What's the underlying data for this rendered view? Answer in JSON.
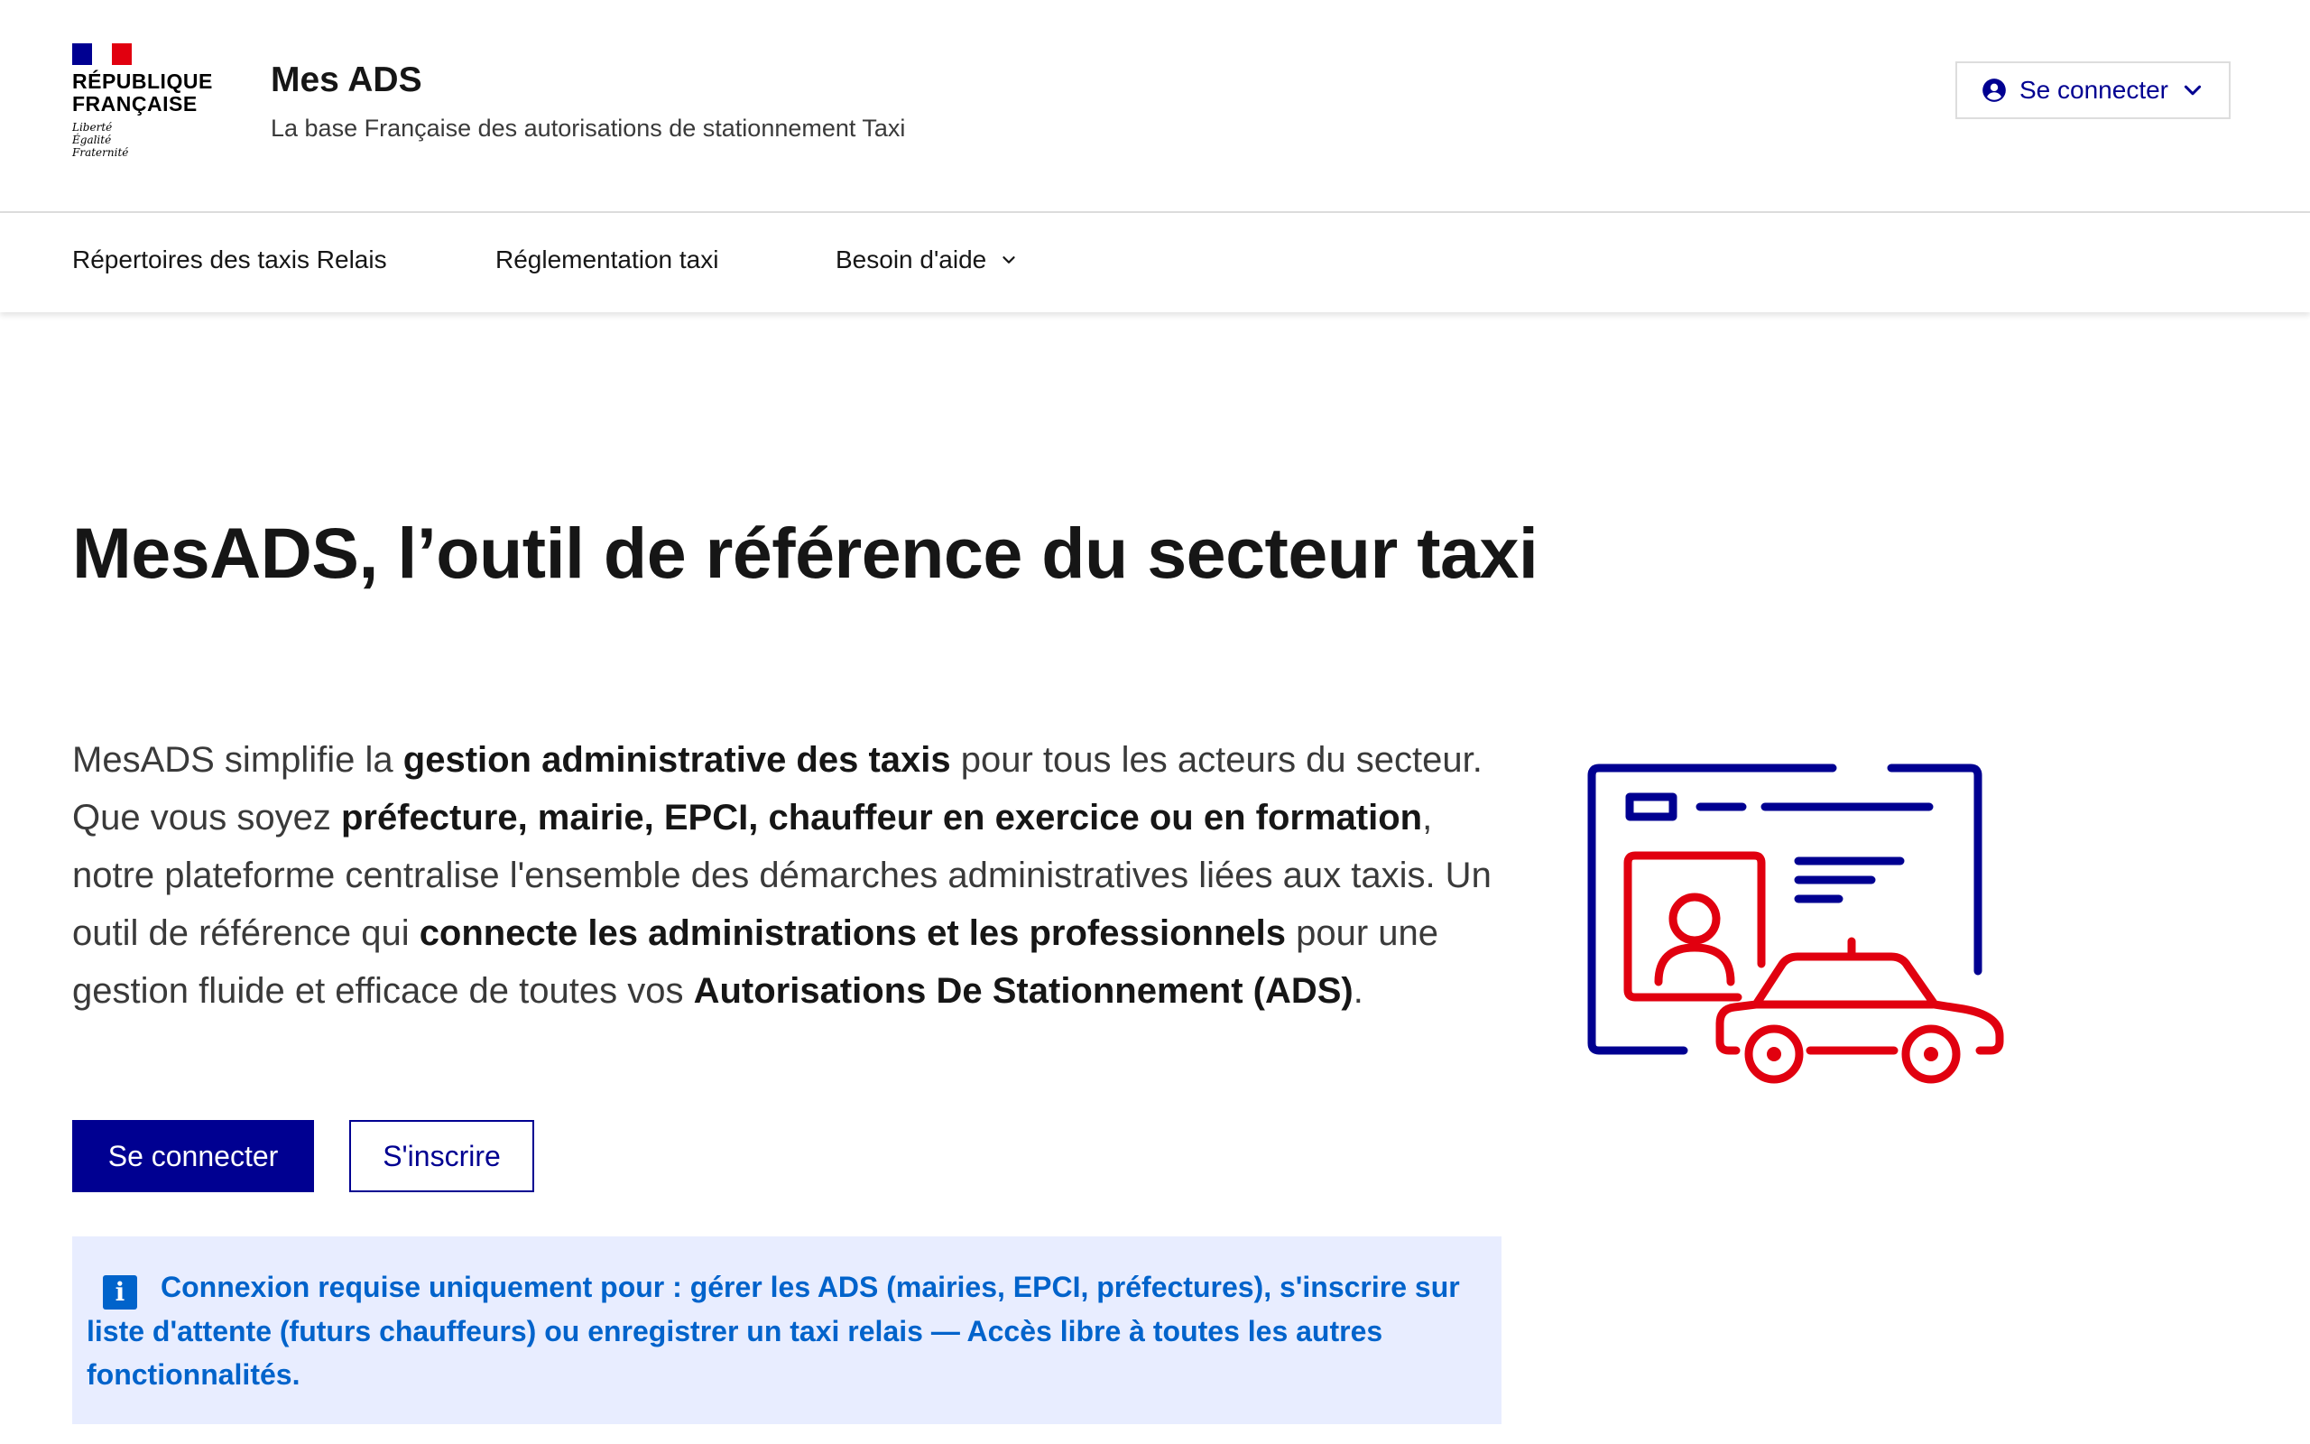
{
  "logo": {
    "title_line1": "RÉPUBLIQUE",
    "title_line2": "FRANÇAISE",
    "motto_line1": "Liberté",
    "motto_line2": "Égalité",
    "motto_line3": "Fraternité"
  },
  "header": {
    "service_title": "Mes ADS",
    "tagline": "La base Française des autorisations de stationnement Taxi",
    "connect_label": "Se connecter"
  },
  "nav": {
    "items": [
      {
        "label": "Répertoires des taxis Relais"
      },
      {
        "label": "Réglementation taxi"
      },
      {
        "label": "Besoin d'aide"
      }
    ]
  },
  "hero": {
    "title": "MesADS, l’outil de référence du secteur taxi",
    "intro_1": "MesADS simplifie la ",
    "bold_1": "gestion administrative des taxis",
    "text_2": " pour tous les acteurs du secteur. Que vous soyez ",
    "bold_2": "préfecture, mairie, EPCI, chauffeur en exercice ou en formation",
    "text_3": ", notre plateforme centralise l'ensemble des démarches administratives liées aux taxis. Un outil de référence qui ",
    "bold_3": "connecte les administrations et les professionnels",
    "text_4": " pour une gestion fluide et efficace de toutes vos ",
    "bold_4": "Autorisations De Stationnement (ADS)",
    "text_5": "."
  },
  "actions": {
    "primary_label": "Se connecter",
    "secondary_label": "S'inscrire"
  },
  "notice": {
    "icon_glyph": "i",
    "text": "Connexion requise uniquement pour : gérer les ADS (mairies, EPCI, préfectures), s'inscrire sur liste d'attente (futurs chauffeurs) ou enregistrer un taxi relais — Accès libre à toutes les autres fonctionnalités."
  },
  "colors": {
    "primary_blue": "#000091",
    "marianne_red": "#e1000f",
    "info_blue": "#0063cb",
    "info_background": "#e8edff"
  },
  "icons": [
    "user-circle-icon",
    "chevron-down-icon",
    "info-icon",
    "taxi-card-illustration"
  ]
}
